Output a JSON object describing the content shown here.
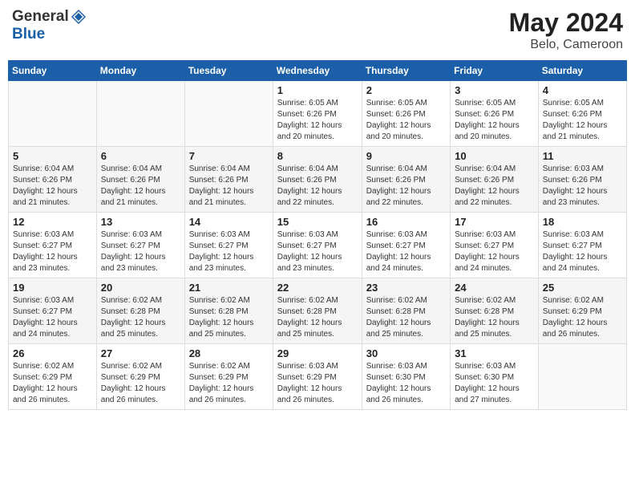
{
  "header": {
    "logo_general": "General",
    "logo_blue": "Blue",
    "month_year": "May 2024",
    "location": "Belo, Cameroon"
  },
  "weekdays": [
    "Sunday",
    "Monday",
    "Tuesday",
    "Wednesday",
    "Thursday",
    "Friday",
    "Saturday"
  ],
  "weeks": [
    [
      {
        "day": "",
        "info": ""
      },
      {
        "day": "",
        "info": ""
      },
      {
        "day": "",
        "info": ""
      },
      {
        "day": "1",
        "info": "Sunrise: 6:05 AM\nSunset: 6:26 PM\nDaylight: 12 hours\nand 20 minutes."
      },
      {
        "day": "2",
        "info": "Sunrise: 6:05 AM\nSunset: 6:26 PM\nDaylight: 12 hours\nand 20 minutes."
      },
      {
        "day": "3",
        "info": "Sunrise: 6:05 AM\nSunset: 6:26 PM\nDaylight: 12 hours\nand 20 minutes."
      },
      {
        "day": "4",
        "info": "Sunrise: 6:05 AM\nSunset: 6:26 PM\nDaylight: 12 hours\nand 21 minutes."
      }
    ],
    [
      {
        "day": "5",
        "info": "Sunrise: 6:04 AM\nSunset: 6:26 PM\nDaylight: 12 hours\nand 21 minutes."
      },
      {
        "day": "6",
        "info": "Sunrise: 6:04 AM\nSunset: 6:26 PM\nDaylight: 12 hours\nand 21 minutes."
      },
      {
        "day": "7",
        "info": "Sunrise: 6:04 AM\nSunset: 6:26 PM\nDaylight: 12 hours\nand 21 minutes."
      },
      {
        "day": "8",
        "info": "Sunrise: 6:04 AM\nSunset: 6:26 PM\nDaylight: 12 hours\nand 22 minutes."
      },
      {
        "day": "9",
        "info": "Sunrise: 6:04 AM\nSunset: 6:26 PM\nDaylight: 12 hours\nand 22 minutes."
      },
      {
        "day": "10",
        "info": "Sunrise: 6:04 AM\nSunset: 6:26 PM\nDaylight: 12 hours\nand 22 minutes."
      },
      {
        "day": "11",
        "info": "Sunrise: 6:03 AM\nSunset: 6:26 PM\nDaylight: 12 hours\nand 23 minutes."
      }
    ],
    [
      {
        "day": "12",
        "info": "Sunrise: 6:03 AM\nSunset: 6:27 PM\nDaylight: 12 hours\nand 23 minutes."
      },
      {
        "day": "13",
        "info": "Sunrise: 6:03 AM\nSunset: 6:27 PM\nDaylight: 12 hours\nand 23 minutes."
      },
      {
        "day": "14",
        "info": "Sunrise: 6:03 AM\nSunset: 6:27 PM\nDaylight: 12 hours\nand 23 minutes."
      },
      {
        "day": "15",
        "info": "Sunrise: 6:03 AM\nSunset: 6:27 PM\nDaylight: 12 hours\nand 23 minutes."
      },
      {
        "day": "16",
        "info": "Sunrise: 6:03 AM\nSunset: 6:27 PM\nDaylight: 12 hours\nand 24 minutes."
      },
      {
        "day": "17",
        "info": "Sunrise: 6:03 AM\nSunset: 6:27 PM\nDaylight: 12 hours\nand 24 minutes."
      },
      {
        "day": "18",
        "info": "Sunrise: 6:03 AM\nSunset: 6:27 PM\nDaylight: 12 hours\nand 24 minutes."
      }
    ],
    [
      {
        "day": "19",
        "info": "Sunrise: 6:03 AM\nSunset: 6:27 PM\nDaylight: 12 hours\nand 24 minutes."
      },
      {
        "day": "20",
        "info": "Sunrise: 6:02 AM\nSunset: 6:28 PM\nDaylight: 12 hours\nand 25 minutes."
      },
      {
        "day": "21",
        "info": "Sunrise: 6:02 AM\nSunset: 6:28 PM\nDaylight: 12 hours\nand 25 minutes."
      },
      {
        "day": "22",
        "info": "Sunrise: 6:02 AM\nSunset: 6:28 PM\nDaylight: 12 hours\nand 25 minutes."
      },
      {
        "day": "23",
        "info": "Sunrise: 6:02 AM\nSunset: 6:28 PM\nDaylight: 12 hours\nand 25 minutes."
      },
      {
        "day": "24",
        "info": "Sunrise: 6:02 AM\nSunset: 6:28 PM\nDaylight: 12 hours\nand 25 minutes."
      },
      {
        "day": "25",
        "info": "Sunrise: 6:02 AM\nSunset: 6:29 PM\nDaylight: 12 hours\nand 26 minutes."
      }
    ],
    [
      {
        "day": "26",
        "info": "Sunrise: 6:02 AM\nSunset: 6:29 PM\nDaylight: 12 hours\nand 26 minutes."
      },
      {
        "day": "27",
        "info": "Sunrise: 6:02 AM\nSunset: 6:29 PM\nDaylight: 12 hours\nand 26 minutes."
      },
      {
        "day": "28",
        "info": "Sunrise: 6:02 AM\nSunset: 6:29 PM\nDaylight: 12 hours\nand 26 minutes."
      },
      {
        "day": "29",
        "info": "Sunrise: 6:03 AM\nSunset: 6:29 PM\nDaylight: 12 hours\nand 26 minutes."
      },
      {
        "day": "30",
        "info": "Sunrise: 6:03 AM\nSunset: 6:30 PM\nDaylight: 12 hours\nand 26 minutes."
      },
      {
        "day": "31",
        "info": "Sunrise: 6:03 AM\nSunset: 6:30 PM\nDaylight: 12 hours\nand 27 minutes."
      },
      {
        "day": "",
        "info": ""
      }
    ]
  ]
}
